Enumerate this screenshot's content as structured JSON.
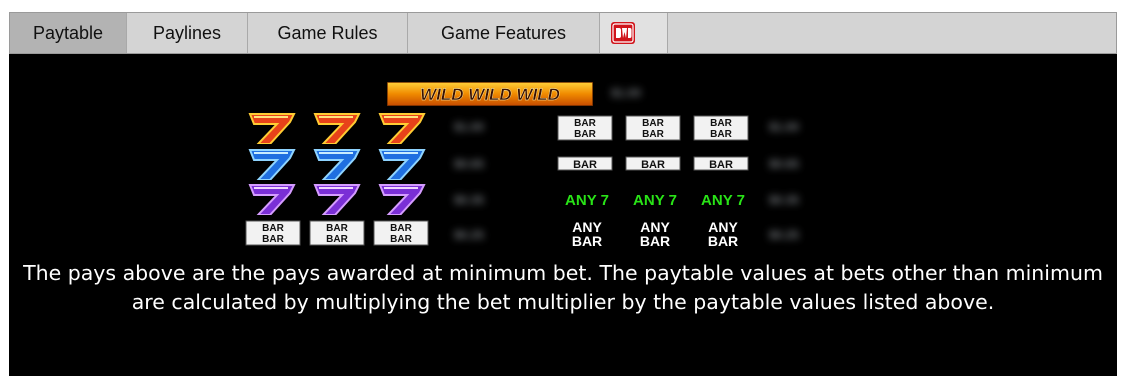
{
  "tabs": [
    {
      "label": "Paytable",
      "active": true
    },
    {
      "label": "Paylines",
      "active": false
    },
    {
      "label": "Game Rules",
      "active": false
    },
    {
      "label": "Game Features",
      "active": false
    }
  ],
  "logo": {
    "icon": "dwd-logo-icon",
    "color": "#d0141b"
  },
  "banner": {
    "text": "WILD WILD WILD"
  },
  "symbols": {
    "bar_text": "BAR",
    "any7_text": "ANY 7",
    "anybar_line1": "ANY",
    "anybar_line2": "BAR"
  },
  "colors": {
    "panel_bg": "#000000",
    "tab_bg": "#d4d4d4",
    "tab_active_bg": "#b3b3b3",
    "any7": "#29e317",
    "red_seven": "#e8421a",
    "blue_seven": "#1f6fe0",
    "purple_seven": "#7a2fd6",
    "banner_orange": "#f08a00"
  },
  "note": "The pays above are the pays awarded at minimum bet. The paytable values at bets other than minimum are calculated by multiplying the bet multiplier by the paytable values listed above."
}
